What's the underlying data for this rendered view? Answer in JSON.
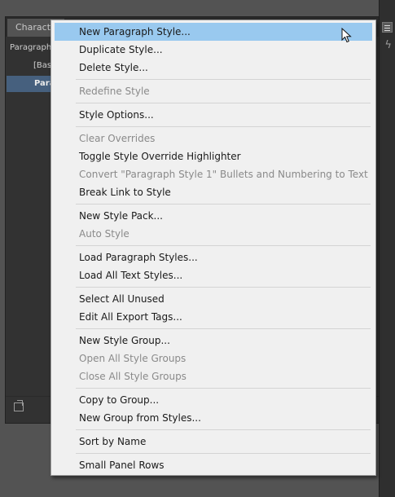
{
  "panel": {
    "tab_label": "Characte",
    "row_header": "Paragraph",
    "row_basic": "[Bas",
    "row_selected": "Para"
  },
  "menu": {
    "items": [
      {
        "label": "New Paragraph Style...",
        "enabled": true,
        "highlighted": true
      },
      {
        "label": "Duplicate Style...",
        "enabled": true
      },
      {
        "label": "Delete Style...",
        "enabled": true
      },
      {
        "label": "Redefine Style",
        "enabled": false
      },
      {
        "label": "Style Options...",
        "enabled": true
      },
      {
        "label": "Clear Overrides",
        "enabled": false
      },
      {
        "label": "Toggle Style Override Highlighter",
        "enabled": true
      },
      {
        "label": "Convert \"Paragraph Style 1\" Bullets and Numbering to Text",
        "enabled": false
      },
      {
        "label": "Break Link to Style",
        "enabled": true
      },
      {
        "label": "New Style Pack...",
        "enabled": true
      },
      {
        "label": "Auto Style",
        "enabled": false
      },
      {
        "label": "Load Paragraph Styles...",
        "enabled": true
      },
      {
        "label": "Load All Text Styles...",
        "enabled": true
      },
      {
        "label": "Select All Unused",
        "enabled": true
      },
      {
        "label": "Edit All Export Tags...",
        "enabled": true
      },
      {
        "label": "New Style Group...",
        "enabled": true
      },
      {
        "label": "Open All Style Groups",
        "enabled": false
      },
      {
        "label": "Close All Style Groups",
        "enabled": false
      },
      {
        "label": "Copy to Group...",
        "enabled": true
      },
      {
        "label": "New Group from Styles...",
        "enabled": true
      },
      {
        "label": "Sort by Name",
        "enabled": true
      },
      {
        "label": "Small Panel Rows",
        "enabled": true
      }
    ]
  },
  "colors": {
    "menu_bg": "#f0f0f0",
    "highlight": "#99c9ef",
    "disabled_text": "#8a8a8a",
    "panel_bg": "#323232"
  }
}
